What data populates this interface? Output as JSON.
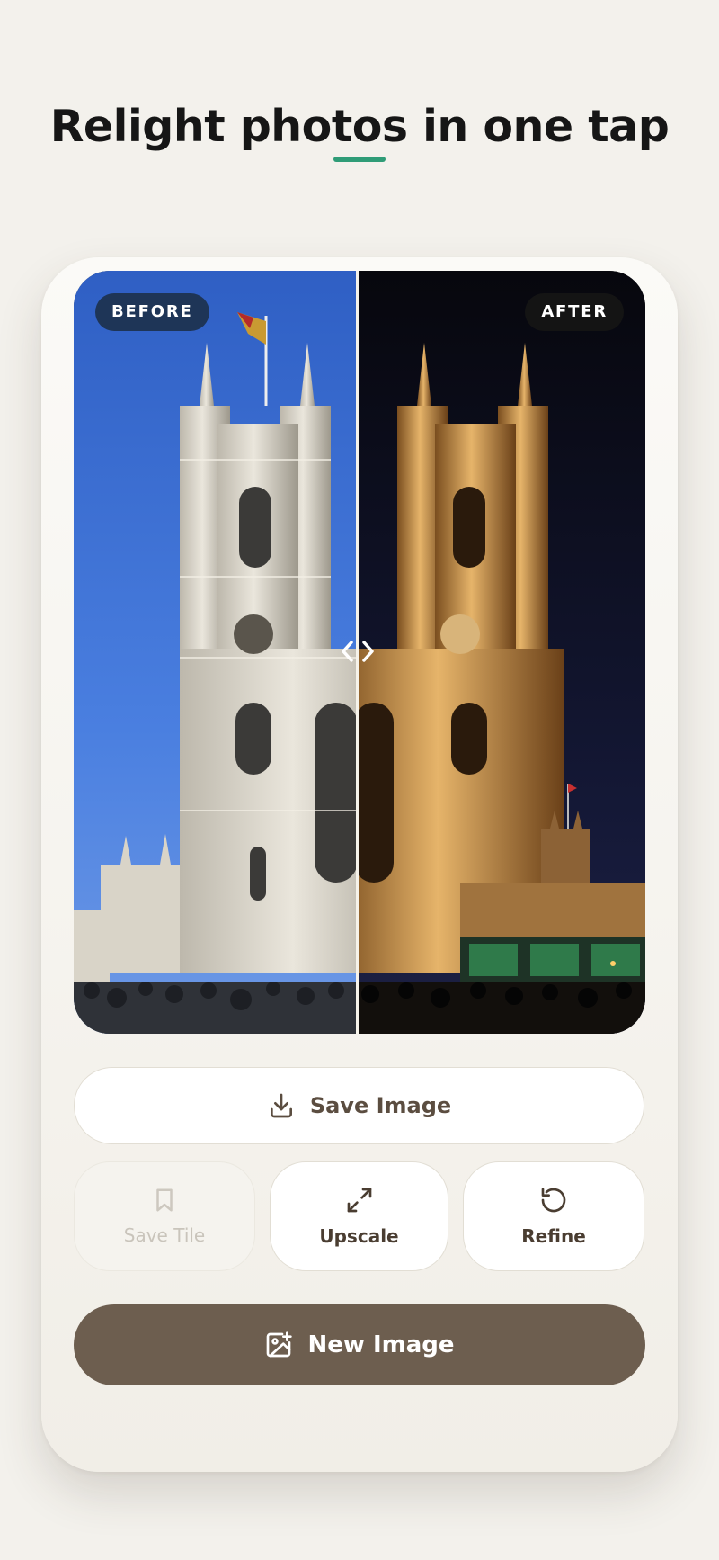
{
  "headline": "Relight photos in one tap",
  "accent_color": "#2f9c77",
  "compare": {
    "before_label": "BEFORE",
    "after_label": "AFTER",
    "before_scene": "daytime cathedral under blue sky",
    "after_scene": "cathedral illuminated at night"
  },
  "actions": {
    "save_image": {
      "label": "Save Image",
      "icon": "download-icon"
    },
    "save_tile": {
      "label": "Save Tile",
      "icon": "bookmark-icon",
      "disabled": true
    },
    "upscale": {
      "label": "Upscale",
      "icon": "expand-arrows-icon"
    },
    "refine": {
      "label": "Refine",
      "icon": "rotate-ccw-icon"
    },
    "new_image": {
      "label": "New Image",
      "icon": "image-plus-icon"
    }
  },
  "colors": {
    "primary_button": "#6d5e4f",
    "before_badge": "#1e3557",
    "after_badge": "#141414"
  }
}
